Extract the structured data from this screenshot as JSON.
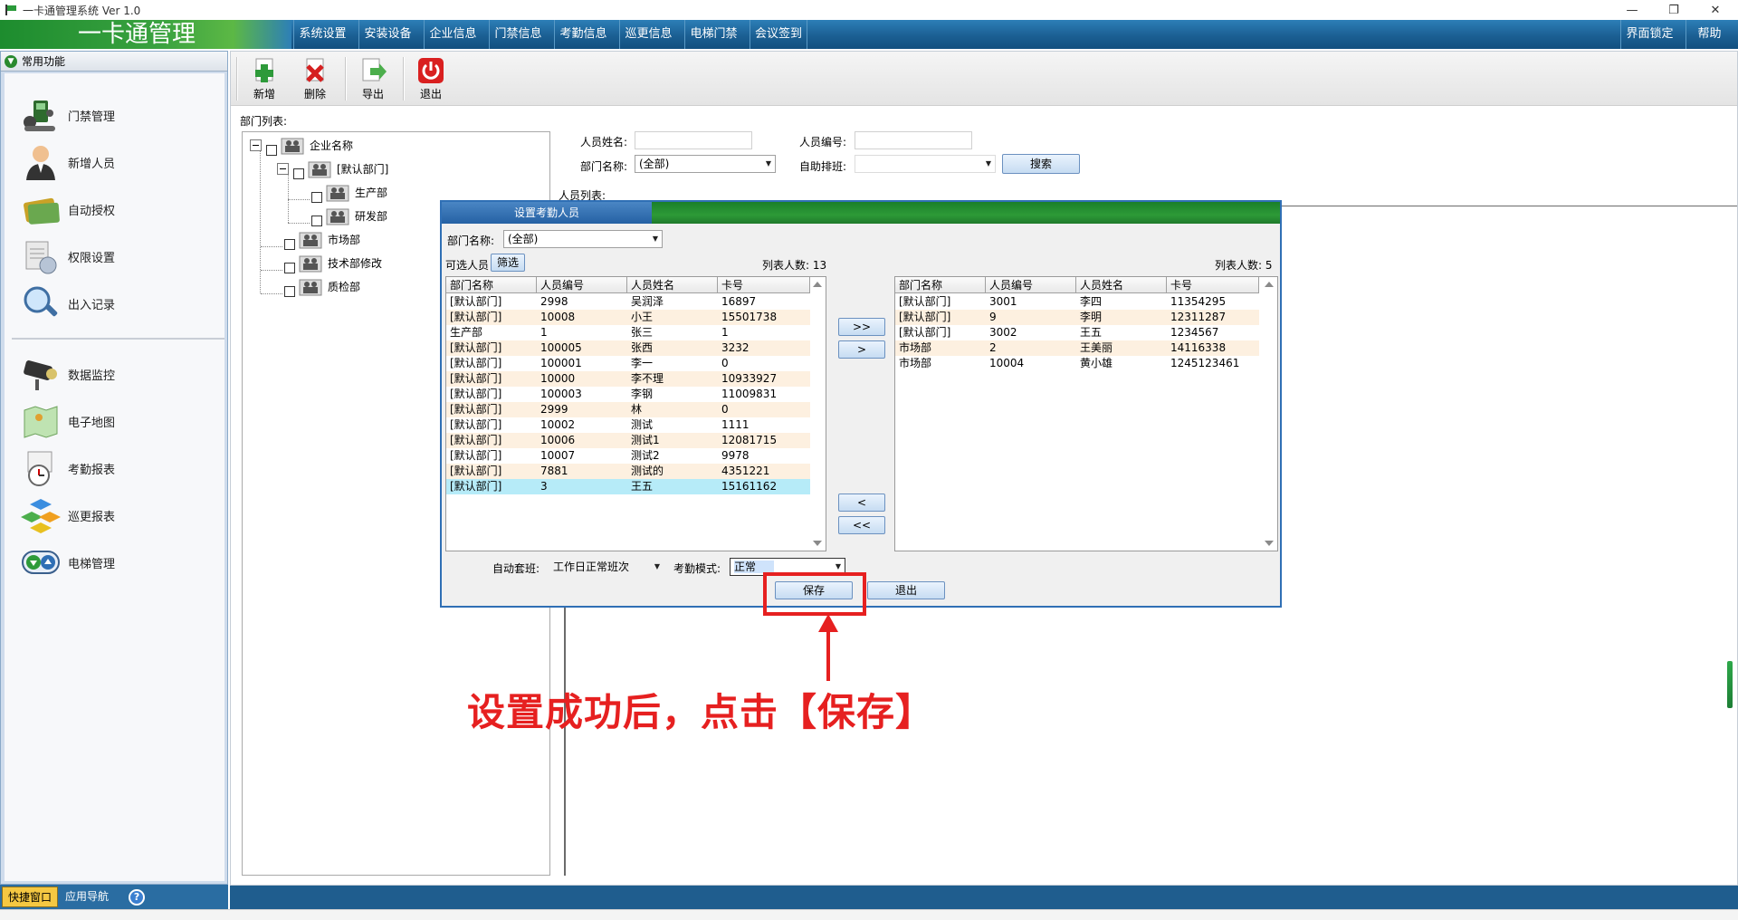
{
  "window": {
    "title": "一卡通管理系统  Ver 1.0"
  },
  "menubar": {
    "brand": "一卡通管理",
    "items": [
      "系统设置",
      "安装设备",
      "企业信息",
      "门禁信息",
      "考勤信息",
      "巡更信息",
      "电梯门禁",
      "会议签到"
    ],
    "right_items": [
      "界面锁定",
      "帮助"
    ]
  },
  "sidebar": {
    "header": "常用功能",
    "items": [
      {
        "label": "门禁管理",
        "icon": "door-access-icon"
      },
      {
        "label": "新增人员",
        "icon": "person-icon"
      },
      {
        "label": "自动授权",
        "icon": "card-icon"
      },
      {
        "label": "权限设置",
        "icon": "permission-doc-icon"
      },
      {
        "label": "出入记录",
        "icon": "magnifier-icon"
      },
      {
        "label": "数据监控",
        "icon": "camera-icon"
      },
      {
        "label": "电子地图",
        "icon": "map-icon"
      },
      {
        "label": "考勤报表",
        "icon": "clock-report-icon"
      },
      {
        "label": "巡更报表",
        "icon": "blocks-icon"
      },
      {
        "label": "电梯管理",
        "icon": "elevator-icon"
      }
    ],
    "tabs": [
      "快捷窗口",
      "应用导航"
    ],
    "help": "?"
  },
  "toolbar": {
    "buttons": [
      {
        "label": "新增",
        "icon": "add-icon"
      },
      {
        "label": "删除",
        "icon": "delete-icon"
      },
      {
        "label": "导出",
        "icon": "export-icon"
      },
      {
        "label": "退出",
        "icon": "power-icon"
      }
    ]
  },
  "dept": {
    "label": "部门列表:",
    "tree": {
      "root": "企业名称",
      "default": "[默认部门]",
      "children_default": [
        "生产部",
        "研发部"
      ],
      "others": [
        "市场部",
        "技术部修改",
        "质检部"
      ]
    }
  },
  "filters": {
    "name_label": "人员姓名:",
    "name_value": "",
    "id_label": "人员编号:",
    "id_value": "",
    "dept_label": "部门名称:",
    "dept_value": "(全部)",
    "shift_label": "自助排班:",
    "shift_value": "",
    "search": "搜索"
  },
  "people_list_label": "人员列表:",
  "dialog": {
    "title": "设置考勤人员",
    "dept_label": "部门名称:",
    "dept_value": "(全部)",
    "available_label": "可选人员",
    "filter_btn": "筛选",
    "left_count": "列表人数: 13",
    "right_count": "列表人数: 5",
    "columns": [
      "部门名称",
      "人员编号",
      "人员姓名",
      "卡号"
    ],
    "left_rows": [
      [
        "[默认部门]",
        "2998",
        "吴润泽",
        "16897"
      ],
      [
        "[默认部门]",
        "10008",
        "小王",
        "15501738"
      ],
      [
        "生产部",
        "1",
        "张三",
        "1"
      ],
      [
        "[默认部门]",
        "100005",
        "张西",
        "3232"
      ],
      [
        "[默认部门]",
        "100001",
        "李一",
        "0"
      ],
      [
        "[默认部门]",
        "10000",
        "李不理",
        "10933927"
      ],
      [
        "[默认部门]",
        "100003",
        "李钢",
        "11009831"
      ],
      [
        "[默认部门]",
        "2999",
        "林",
        "0"
      ],
      [
        "[默认部门]",
        "10002",
        "测试",
        "1111"
      ],
      [
        "[默认部门]",
        "10006",
        "测试1",
        "12081715"
      ],
      [
        "[默认部门]",
        "10007",
        "测试2",
        "9978"
      ],
      [
        "[默认部门]",
        "7881",
        "测试的",
        "4351221"
      ],
      [
        "[默认部门]",
        "3",
        "王五",
        "15161162"
      ]
    ],
    "right_rows": [
      [
        "[默认部门]",
        "3001",
        "李四",
        "11354295"
      ],
      [
        "[默认部门]",
        "9",
        "李明",
        "12311287"
      ],
      [
        "[默认部门]",
        "3002",
        "王五",
        "1234567"
      ],
      [
        "市场部",
        "2",
        "王美丽",
        "14116338"
      ],
      [
        "市场部",
        "10004",
        "黄小雄",
        "1245123461"
      ]
    ],
    "move_buttons": [
      ">>",
      ">",
      "<",
      "<<"
    ],
    "auto_shift_label": "自动套班:",
    "auto_shift_value": "工作日正常班次",
    "mode_label": "考勤模式:",
    "mode_value": "正常",
    "save": "保存",
    "exit": "退出"
  },
  "annotation": {
    "text": "设置成功后，点击【保存】",
    "color": "#e62020"
  }
}
